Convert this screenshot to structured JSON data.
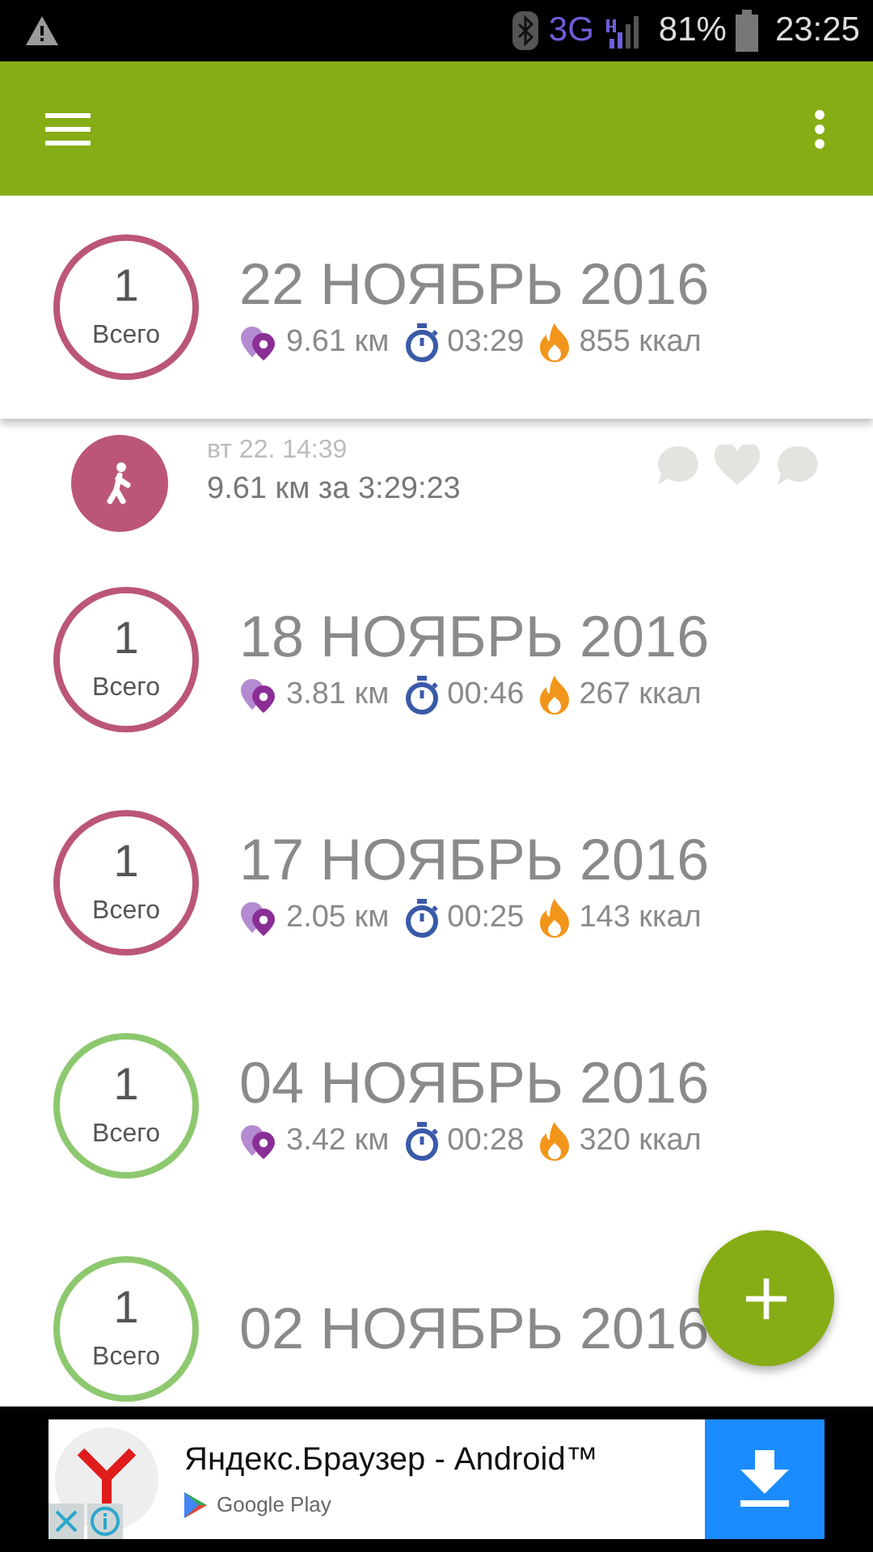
{
  "status_bar": {
    "network": "3G",
    "battery": "81%",
    "time": "23:25"
  },
  "days": [
    {
      "count": "1",
      "count_label": "Всего",
      "date": "22 НОЯБРЬ 2016",
      "distance": "9.61 км",
      "duration": "03:29",
      "calories": "855 ккал",
      "color": "#bb5677",
      "expanded": true,
      "activities": [
        {
          "time": "вт 22. 14:39",
          "summary": "9.61 км за 3:29:23"
        }
      ]
    },
    {
      "count": "1",
      "count_label": "Всего",
      "date": "18 НОЯБРЬ 2016",
      "distance": "3.81 км",
      "duration": "00:46",
      "calories": "267 ккал",
      "color": "#bb5677",
      "expanded": false
    },
    {
      "count": "1",
      "count_label": "Всего",
      "date": "17 НОЯБРЬ 2016",
      "distance": "2.05 км",
      "duration": "00:25",
      "calories": "143 ккал",
      "color": "#bb5677",
      "expanded": false
    },
    {
      "count": "1",
      "count_label": "Всего",
      "date": "04 НОЯБРЬ 2016",
      "distance": "3.42 км",
      "duration": "00:28",
      "calories": "320 ккал",
      "color": "#8dc86f",
      "expanded": false
    },
    {
      "count": "1",
      "count_label": "Всего",
      "date": "02 НОЯБРЬ 2016",
      "color": "#8dc86f",
      "expanded": false
    }
  ],
  "fab": "+",
  "ad": {
    "title": "Яндекс.Браузер - Android™",
    "store": "Google Play"
  }
}
